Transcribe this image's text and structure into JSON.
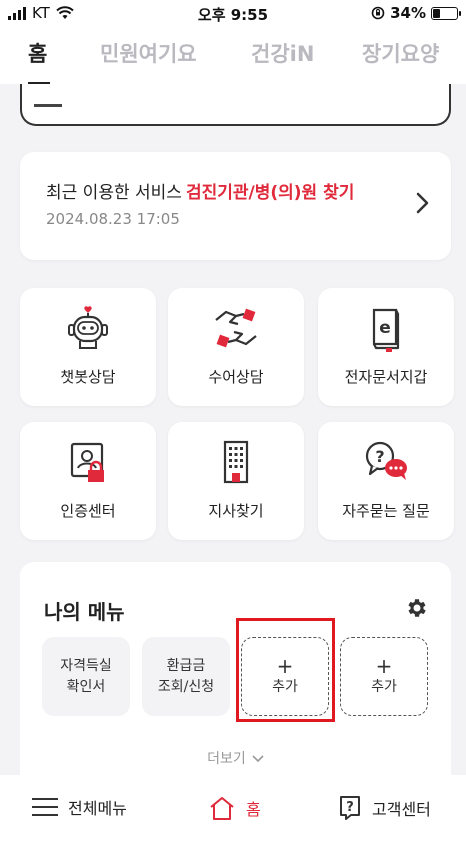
{
  "status_bar": {
    "carrier": "KT",
    "time": "오후 9:55",
    "battery": "34%",
    "battery_level": 0.34
  },
  "tabs": [
    {
      "label": "홈",
      "active": true
    },
    {
      "label": "민원여기요",
      "active": false
    },
    {
      "label": "건강iN",
      "active": false
    },
    {
      "label": "장기요양",
      "active": false
    }
  ],
  "recent_service": {
    "prefix": "최근 이용한 서비스",
    "service_name": "검진기관/병(의)원 찾기",
    "datetime": "2024.08.23 17:05"
  },
  "services": [
    {
      "label": "챗봇상담",
      "icon": "chatbot-icon"
    },
    {
      "label": "수어상담",
      "icon": "sign-language-icon"
    },
    {
      "label": "전자문서지갑",
      "icon": "e-document-wallet-icon"
    },
    {
      "label": "인증센터",
      "icon": "certificate-lock-icon"
    },
    {
      "label": "지사찾기",
      "icon": "building-icon"
    },
    {
      "label": "자주묻는 질문",
      "icon": "faq-bubble-icon"
    }
  ],
  "my_menu": {
    "title": "나의 메뉴",
    "items": [
      {
        "line1": "자격득실",
        "line2": "확인서"
      },
      {
        "line1": "환급금",
        "line2": "조회/신청"
      }
    ],
    "add_plus": "+",
    "add_label": "추가",
    "more_label": "더보기"
  },
  "bottom_nav": {
    "menu": "전체메뉴",
    "home": "홈",
    "support": "고객센터"
  },
  "colors": {
    "accent": "#e0293a",
    "highlight_box": "#e0181f",
    "background": "#f3f3f5"
  }
}
